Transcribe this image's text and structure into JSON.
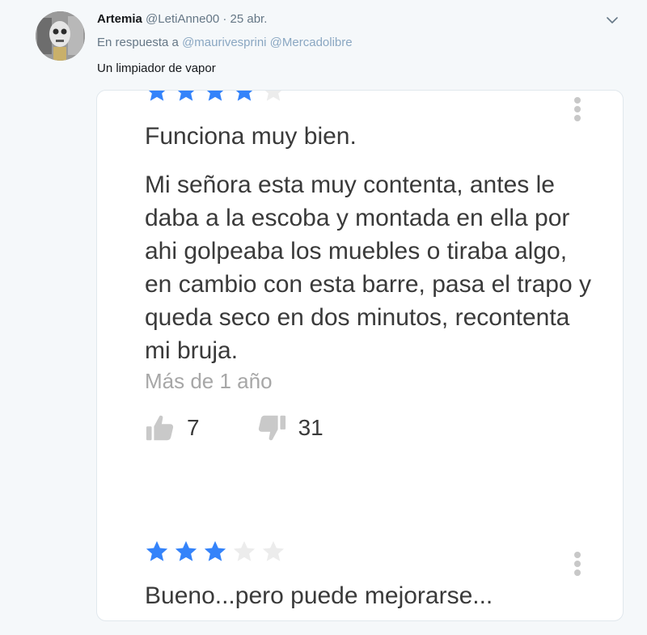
{
  "tweet": {
    "author_name": "Artemia",
    "handle": "@LetiAnne00",
    "separator": "·",
    "date": "25 abr.",
    "reply_prefix": "En respuesta a",
    "reply_mentions": "@maurivesprini @Mercadolibre",
    "text": "Un limpiador de vapor"
  },
  "reviews": [
    {
      "rating": 4,
      "max_rating": 5,
      "title": "Funciona muy bien.",
      "body": "Mi señora esta muy contenta, antes le daba a la escoba y montada en ella por ahi golpeaba los muebles o tiraba algo, en cambio con esta barre, pasa el trapo y queda seco en dos minutos, recontenta mi bruja.",
      "date": "Más de 1 año",
      "likes": "7",
      "dislikes": "31"
    },
    {
      "rating": 3,
      "max_rating": 5,
      "title": "Bueno...pero puede mejorarse..."
    }
  ],
  "colors": {
    "star_filled": "#3483fa",
    "star_empty": "#ececec",
    "muted_text": "#657786",
    "link_text": "#8aa7c2"
  },
  "icons": {
    "caret": "chevron-down-icon",
    "menu": "kebab-menu-icon",
    "like": "thumbs-up-icon",
    "dislike": "thumbs-down-icon",
    "star": "star-icon"
  }
}
